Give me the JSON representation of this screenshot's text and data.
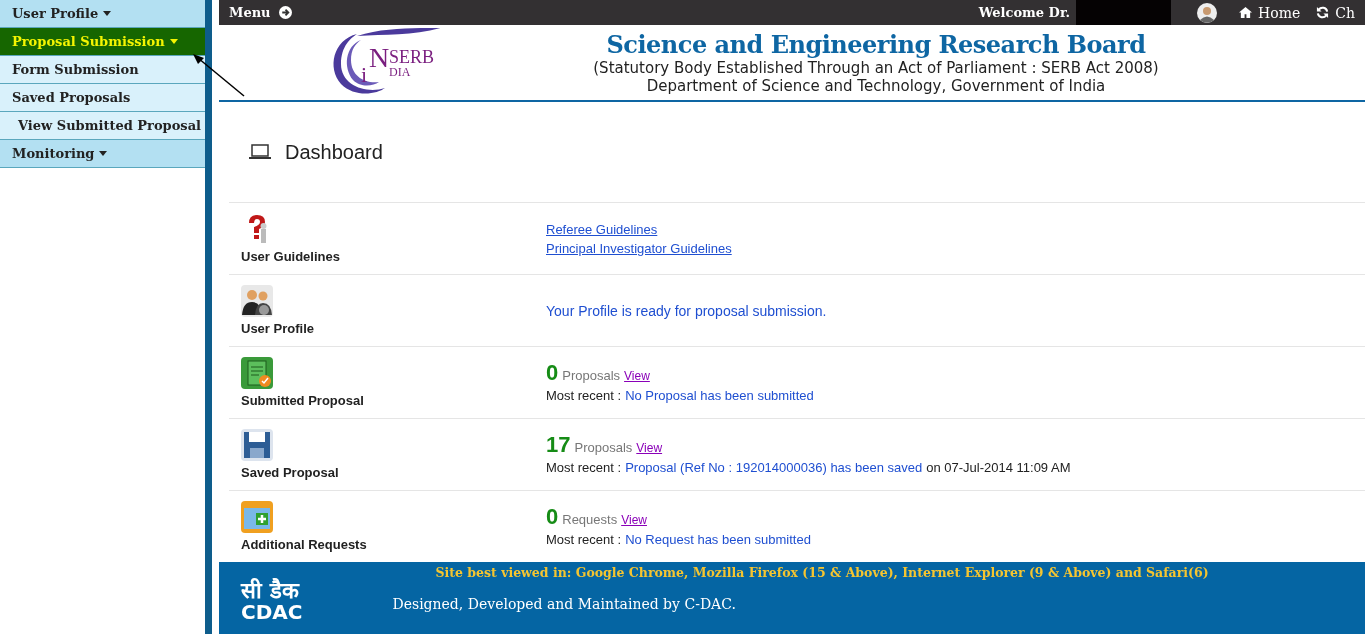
{
  "sidebar": {
    "items": [
      {
        "label": "User Profile",
        "kind": "section",
        "selected": false
      },
      {
        "label": "Proposal Submission",
        "kind": "section",
        "selected": true
      },
      {
        "label": "Form Submission",
        "kind": "subitem",
        "selected": false
      },
      {
        "label": "Saved Proposals",
        "kind": "subitem",
        "selected": false
      },
      {
        "label": "View Submitted Proposal",
        "kind": "subitem",
        "selected": false
      },
      {
        "label": "Monitoring",
        "kind": "section",
        "selected": false
      }
    ]
  },
  "topbar": {
    "menu": "Menu",
    "welcome": "Welcome Dr.",
    "nav": [
      {
        "label": "Home"
      },
      {
        "label": "Ch"
      }
    ]
  },
  "header": {
    "logo_i": "i",
    "logo_n": "N",
    "logo_serb": "SERB",
    "logo_dia": "DIA",
    "title": "Science and Engineering Research Board",
    "subtitle": "(Statutory Body Established Through an Act of Parliament : SERB Act 2008)",
    "department": "Department of Science and Technology, Government of India"
  },
  "dashboard": {
    "title": "Dashboard"
  },
  "rows": [
    {
      "kind": "links",
      "label": "User Guidelines",
      "links": [
        "Referee Guidelines",
        "Principal Investigator Guidelines"
      ]
    },
    {
      "kind": "message",
      "label": "User Profile",
      "message": "Your Profile is ready for proposal submission."
    },
    {
      "kind": "count",
      "label": "Submitted Proposal",
      "count": "0",
      "unit": "Proposals",
      "view": "View",
      "recent_label": "Most recent :",
      "recent": "No Proposal has been submitted"
    },
    {
      "kind": "count",
      "label": "Saved Proposal",
      "count": "17",
      "unit": "Proposals",
      "view": "View",
      "recent_label": "Most recent :",
      "recent": "Proposal (Ref No : 192014000036) has been saved",
      "recent_suffix": "on 07-Jul-2014 11:09 AM"
    },
    {
      "kind": "count",
      "label": "Additional Requests",
      "count": "0",
      "unit": "Requests",
      "view": "View",
      "recent_label": "Most recent :",
      "recent": "No Request has been submitted"
    }
  ],
  "footer": {
    "notice": "Site best viewed in: Google Chrome, Mozilla Firefox (15 & Above), Internet Explorer (9 & Above) and Safari(6)",
    "logo_hindi": "सी डैक",
    "logo_latin": "CDAC",
    "credit": "Designed, Developed and Maintained by C-DAC."
  }
}
